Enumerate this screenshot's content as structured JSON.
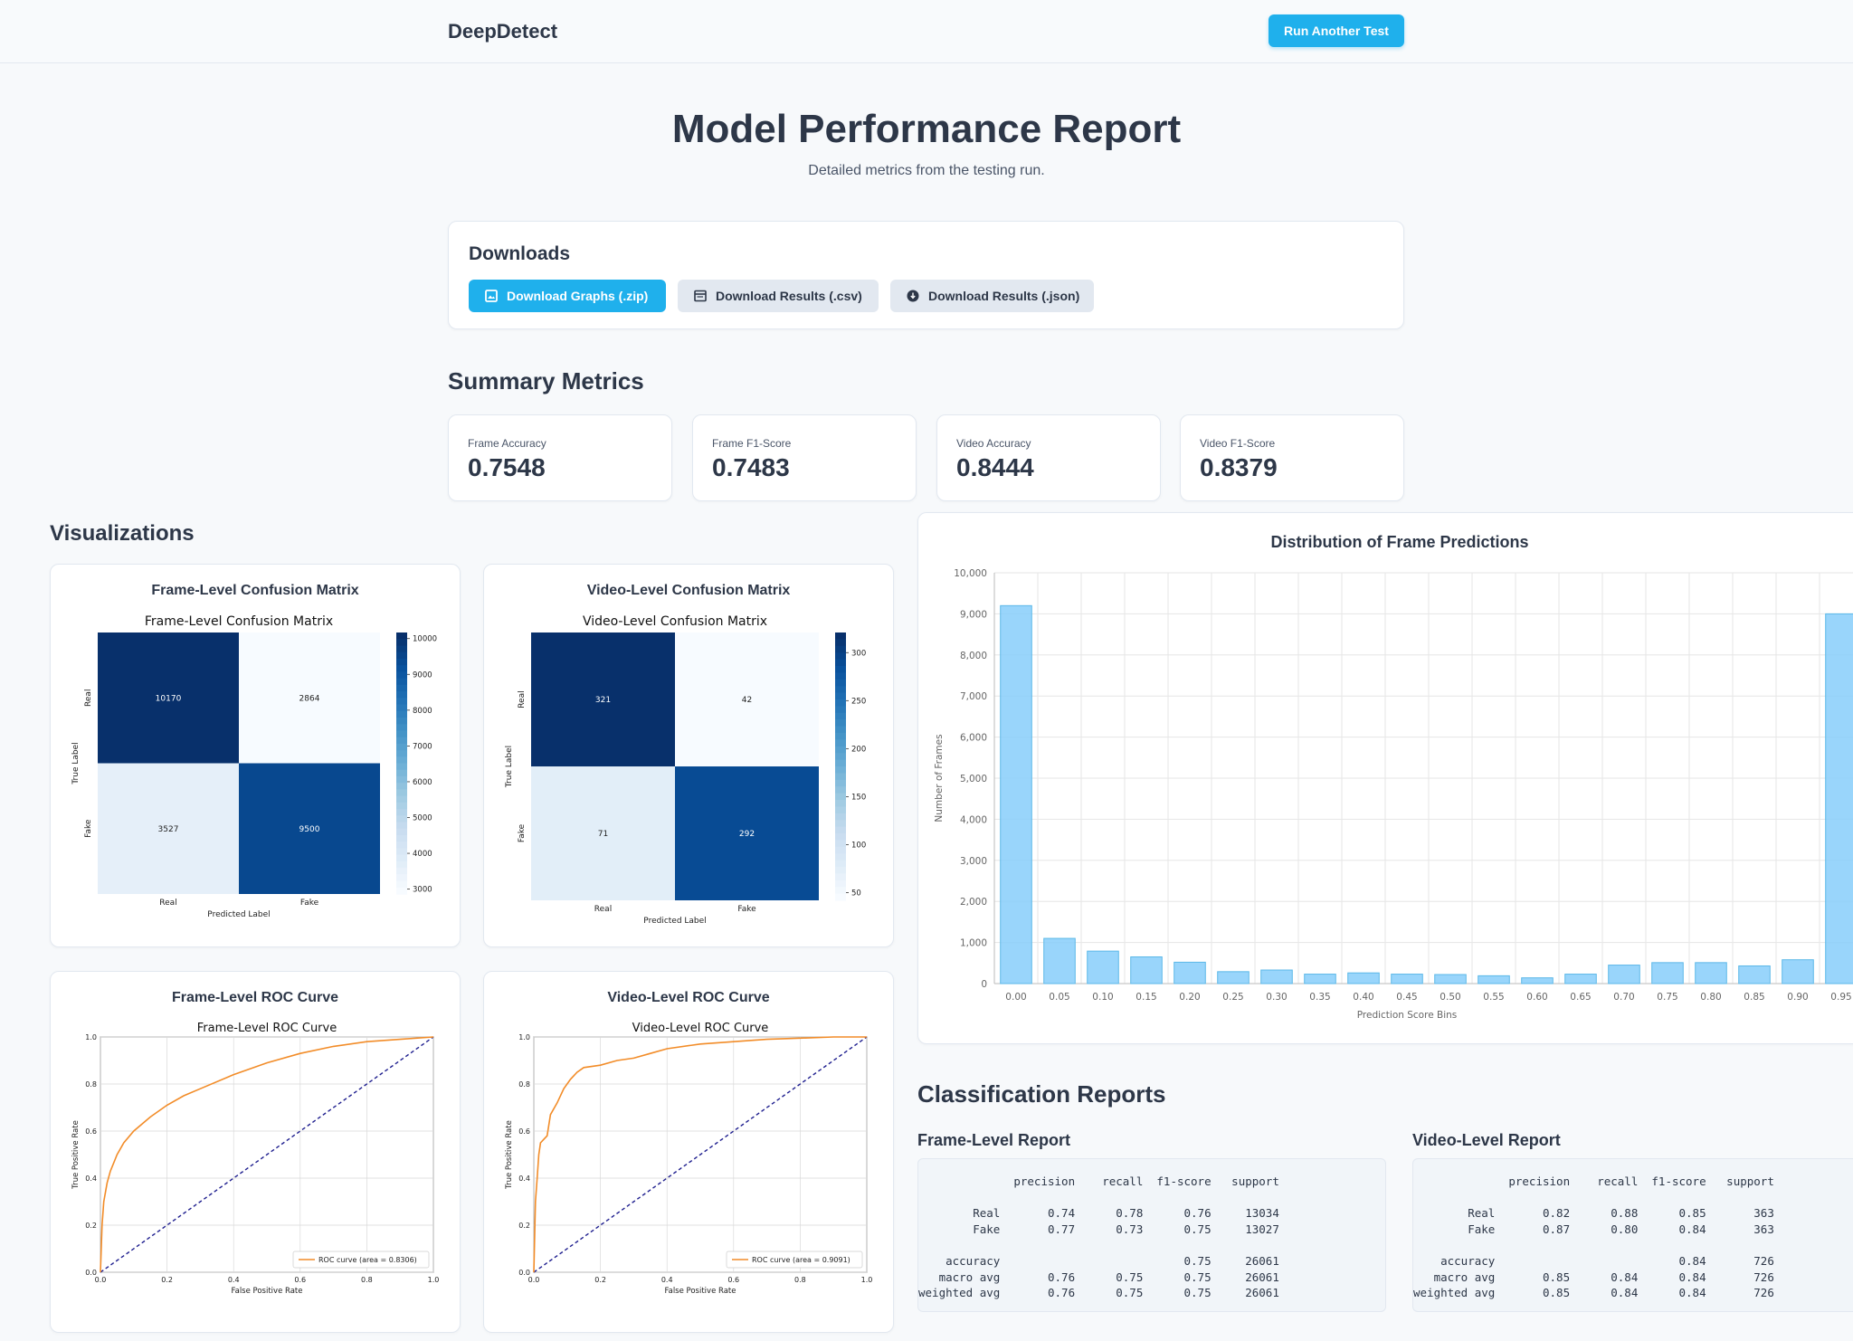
{
  "header": {
    "brand": "DeepDetect",
    "run_button": "Run Another Test"
  },
  "page": {
    "title": "Model Performance Report",
    "subtitle": "Detailed metrics from the testing run."
  },
  "downloads": {
    "title": "Downloads",
    "buttons": [
      "Download Graphs (.zip)",
      "Download Results (.csv)",
      "Download Results (.json)"
    ]
  },
  "summary": {
    "title": "Summary Metrics",
    "metrics": [
      {
        "label": "Frame Accuracy",
        "value": "0.7548"
      },
      {
        "label": "Frame F1-Score",
        "value": "0.7483"
      },
      {
        "label": "Video Accuracy",
        "value": "0.8444"
      },
      {
        "label": "Video F1-Score",
        "value": "0.8379"
      }
    ]
  },
  "visualizations": {
    "title": "Visualizations",
    "frame_cm": {
      "card_title": "Frame-Level Confusion Matrix",
      "plot_title": "Frame-Level Confusion Matrix"
    },
    "video_cm": {
      "card_title": "Video-Level Confusion Matrix",
      "plot_title": "Video-Level Confusion Matrix"
    },
    "frame_roc": {
      "card_title": "Frame-Level ROC Curve",
      "plot_title": "Frame-Level ROC Curve",
      "legend": "ROC curve (area = 0.8306)"
    },
    "video_roc": {
      "card_title": "Video-Level ROC Curve",
      "plot_title": "Video-Level ROC Curve",
      "legend": "ROC curve (area = 0.9091)"
    },
    "hist": {
      "card_title": "Distribution of Frame Predictions"
    }
  },
  "chart_data": [
    {
      "type": "heatmap",
      "title": "Frame-Level Confusion Matrix",
      "xlabel": "Predicted Label",
      "ylabel": "True Label",
      "x_categories": [
        "Real",
        "Fake"
      ],
      "y_categories": [
        "Real",
        "Fake"
      ],
      "values": [
        [
          10170,
          2864
        ],
        [
          3527,
          9500
        ]
      ],
      "colorbar_ticks": [
        "10000",
        "9000",
        "8000",
        "7000",
        "6000",
        "5000",
        "4000",
        "3000"
      ]
    },
    {
      "type": "heatmap",
      "title": "Video-Level Confusion Matrix",
      "xlabel": "Predicted Label",
      "ylabel": "True Label",
      "x_categories": [
        "Real",
        "Fake"
      ],
      "y_categories": [
        "Real",
        "Fake"
      ],
      "values": [
        [
          321,
          42
        ],
        [
          71,
          292
        ]
      ],
      "colorbar_ticks": [
        "300",
        "250",
        "200",
        "150",
        "100",
        "50"
      ]
    },
    {
      "type": "line",
      "title": "Frame-Level ROC Curve",
      "xlabel": "False Positive Rate",
      "ylabel": "True Positive Rate",
      "xlim": [
        0,
        1
      ],
      "ylim": [
        0,
        1
      ],
      "ticks": [
        "0.0",
        "0.2",
        "0.4",
        "0.6",
        "0.8",
        "1.0"
      ],
      "series": [
        {
          "name": "ROC curve (area = 0.8306)",
          "color": "#f28c28",
          "x": [
            0,
            0.005,
            0.01,
            0.02,
            0.03,
            0.05,
            0.07,
            0.1,
            0.15,
            0.2,
            0.25,
            0.3,
            0.4,
            0.5,
            0.6,
            0.7,
            0.8,
            0.9,
            1.0
          ],
          "y": [
            0,
            0.2,
            0.3,
            0.38,
            0.43,
            0.5,
            0.55,
            0.6,
            0.66,
            0.71,
            0.75,
            0.78,
            0.84,
            0.89,
            0.93,
            0.96,
            0.98,
            0.99,
            1.0
          ]
        }
      ],
      "diagonal": true
    },
    {
      "type": "line",
      "title": "Video-Level ROC Curve",
      "xlabel": "False Positive Rate",
      "ylabel": "True Positive Rate",
      "xlim": [
        0,
        1
      ],
      "ylim": [
        0,
        1
      ],
      "ticks": [
        "0.0",
        "0.2",
        "0.4",
        "0.6",
        "0.8",
        "1.0"
      ],
      "series": [
        {
          "name": "ROC curve (area = 0.9091)",
          "color": "#f28c28",
          "x": [
            0,
            0.005,
            0.01,
            0.015,
            0.02,
            0.04,
            0.05,
            0.07,
            0.09,
            0.11,
            0.13,
            0.15,
            0.2,
            0.25,
            0.3,
            0.35,
            0.4,
            0.5,
            0.6,
            0.7,
            0.8,
            0.9,
            1.0
          ],
          "y": [
            0,
            0.3,
            0.4,
            0.5,
            0.55,
            0.58,
            0.67,
            0.72,
            0.78,
            0.82,
            0.85,
            0.87,
            0.88,
            0.9,
            0.91,
            0.93,
            0.95,
            0.97,
            0.98,
            0.99,
            0.995,
            1.0,
            1.0
          ]
        }
      ],
      "diagonal": true
    },
    {
      "type": "bar",
      "title": "Distribution of Frame Predictions",
      "xlabel": "Prediction Score Bins",
      "ylabel": "Number of Frames",
      "categories": [
        "0.00",
        "0.05",
        "0.10",
        "0.15",
        "0.20",
        "0.25",
        "0.30",
        "0.35",
        "0.40",
        "0.45",
        "0.50",
        "0.55",
        "0.60",
        "0.65",
        "0.70",
        "0.75",
        "0.80",
        "0.85",
        "0.90",
        "0.95"
      ],
      "values": [
        9200,
        1100,
        790,
        650,
        520,
        290,
        330,
        230,
        260,
        230,
        220,
        190,
        140,
        230,
        450,
        510,
        510,
        430,
        580,
        9000
      ],
      "ylim": [
        0,
        10000
      ],
      "yticks": [
        "0",
        "1,000",
        "2,000",
        "3,000",
        "4,000",
        "5,000",
        "6,000",
        "7,000",
        "8,000",
        "9,000",
        "10,000"
      ],
      "bar_color": "#87cefa"
    }
  ],
  "reports": {
    "title": "Classification Reports",
    "frame_title": "Frame-Level Report",
    "video_title": "Video-Level Report",
    "frame_text": "              precision    recall  f1-score   support\n\n        Real       0.74      0.78      0.76     13034\n        Fake       0.77      0.73      0.75     13027\n\n    accuracy                           0.75     26061\n   macro avg       0.76      0.75      0.75     26061\nweighted avg       0.76      0.75      0.75     26061",
    "video_text": "              precision    recall  f1-score   support\n\n        Real       0.82      0.88      0.85       363\n        Fake       0.87      0.80      0.84       363\n\n    accuracy                           0.84       726\n   macro avg       0.85      0.84      0.84       726\nweighted avg       0.85      0.84      0.84       726"
  }
}
